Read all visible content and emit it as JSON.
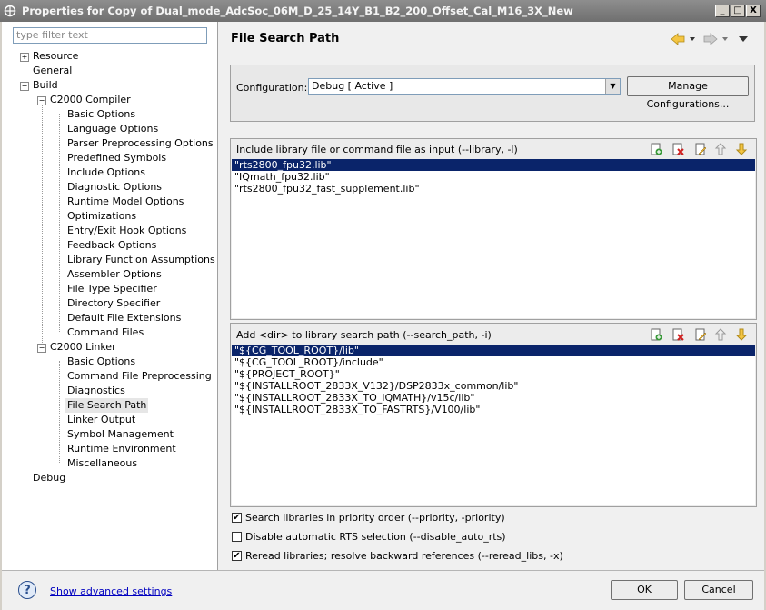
{
  "window": {
    "title": "Properties for Copy of Dual_mode_AdcSoc_06M_D_25_14Y_B1_B2_200_Offset_Cal_M16_3X_New",
    "minimize": "_",
    "maximize": "□",
    "close": "X"
  },
  "left": {
    "filter_placeholder": "type filter text",
    "tree": [
      {
        "label": "Resource",
        "expand": "+"
      },
      {
        "label": "General"
      },
      {
        "label": "Build",
        "expand": "−"
      },
      {
        "label": "C2000 Compiler",
        "expand": "−"
      },
      {
        "label": "Basic Options"
      },
      {
        "label": "Language Options"
      },
      {
        "label": "Parser Preprocessing Options"
      },
      {
        "label": "Predefined Symbols"
      },
      {
        "label": "Include Options"
      },
      {
        "label": "Diagnostic Options"
      },
      {
        "label": "Runtime Model Options"
      },
      {
        "label": "Optimizations"
      },
      {
        "label": "Entry/Exit Hook Options"
      },
      {
        "label": "Feedback Options"
      },
      {
        "label": "Library Function Assumptions"
      },
      {
        "label": "Assembler Options"
      },
      {
        "label": "File Type Specifier"
      },
      {
        "label": "Directory Specifier"
      },
      {
        "label": "Default File Extensions"
      },
      {
        "label": "Command Files"
      },
      {
        "label": "C2000 Linker",
        "expand": "−"
      },
      {
        "label": "Basic Options"
      },
      {
        "label": "Command File Preprocessing"
      },
      {
        "label": "Diagnostics"
      },
      {
        "label": "File Search Path"
      },
      {
        "label": "Linker Output"
      },
      {
        "label": "Symbol Management"
      },
      {
        "label": "Runtime Environment"
      },
      {
        "label": "Miscellaneous"
      },
      {
        "label": "Debug"
      }
    ]
  },
  "main": {
    "title": "File Search Path",
    "configuration_label": "Configuration:",
    "configuration_value": "Debug  [ Active ]",
    "manage_button": "Manage Configurations...",
    "libs": {
      "header": "Include library file or command file as input (--library, -l)",
      "items": [
        "\"rts2800_fpu32.lib\"",
        "\"IQmath_fpu32.lib\"",
        "\"rts2800_fpu32_fast_supplement.lib\""
      ]
    },
    "paths": {
      "header": "Add <dir> to library search path (--search_path, -i)",
      "items": [
        "\"${CG_TOOL_ROOT}/lib\"",
        "\"${CG_TOOL_ROOT}/include\"",
        "\"${PROJECT_ROOT}\"",
        "\"${INSTALLROOT_2833X_V132}/DSP2833x_common/lib\"",
        "\"${INSTALLROOT_2833X_TO_IQMATH}/v15c/lib\"",
        "\"${INSTALLROOT_2833X_TO_FASTRTS}/V100/lib\""
      ]
    },
    "options": [
      {
        "label": "Search libraries in priority order (--priority, -priority)",
        "checked": true
      },
      {
        "label": "Disable automatic RTS selection (--disable_auto_rts)",
        "checked": false
      },
      {
        "label": "Reread libraries; resolve backward references (--reread_libs, -x)",
        "checked": true
      }
    ]
  },
  "footer": {
    "help": "?",
    "advanced_link": "Show advanced settings",
    "ok": "OK",
    "cancel": "Cancel"
  },
  "checkmark": "✔",
  "combo_arrow": "▼"
}
